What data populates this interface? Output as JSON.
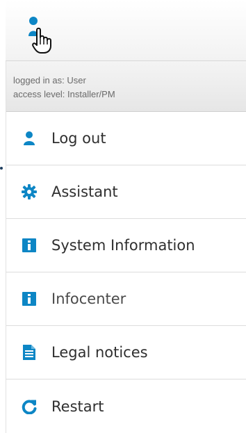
{
  "colors": {
    "accent": "#0d86c5",
    "text": "#2f2f2f",
    "muted_text": "#6a6a6a",
    "panel_bg": "#ececec"
  },
  "header": {
    "user_icon": "user-icon",
    "cursor_icon": "hand-cursor-icon"
  },
  "session": {
    "logged_in_line": "logged in as: User",
    "access_level_line": "access level: Installer/PM"
  },
  "menu": {
    "items": [
      {
        "label": "Log out",
        "icon": "user-icon"
      },
      {
        "label": "Assistant",
        "icon": "gear-icon"
      },
      {
        "label": "System Information",
        "icon": "info-icon"
      },
      {
        "label": "Infocenter",
        "icon": "info-icon"
      },
      {
        "label": "Legal notices",
        "icon": "document-icon"
      },
      {
        "label": "Restart",
        "icon": "refresh-icon"
      }
    ]
  }
}
